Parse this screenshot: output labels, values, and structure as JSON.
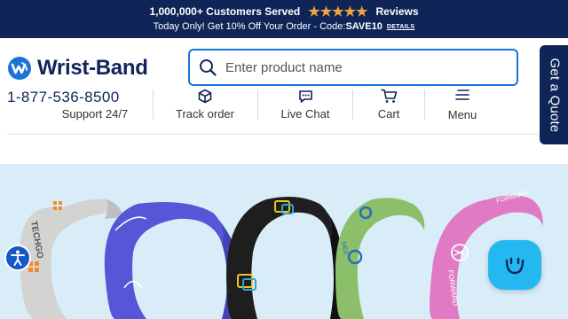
{
  "promo": {
    "customers": "1,000,000+ Customers Served",
    "stars": [
      "★",
      "★",
      "★",
      "★",
      "★"
    ],
    "reviews": "Reviews",
    "offer": "Today Only! Get 10% Off Your Order - Code: ",
    "code": "SAVE10",
    "details": "DETAILS"
  },
  "brand": {
    "name": "Wrist-Band"
  },
  "search": {
    "placeholder": "Enter product name"
  },
  "contact": {
    "phone": "1-877-536-8500"
  },
  "nav": {
    "support": "Support 24/7",
    "track": "Track order",
    "chat": "Live Chat",
    "cart": "Cart",
    "menu": "Menu"
  },
  "quote_tab": {
    "label": "Get a Quote"
  },
  "colors": {
    "navy": "#0f2557",
    "accent_blue": "#1a73d9",
    "star": "#f3a33a",
    "hero_bg": "#d9edf9",
    "chat_bubble": "#23b8f0"
  },
  "hero": {
    "bands": [
      {
        "color": "#d3d4d2",
        "print_text": "TECHGO",
        "icon": "dot-grid-logo"
      },
      {
        "color": "#5656d6",
        "print_text": "",
        "icon": "swoosh-logo"
      },
      {
        "color": "#1e1e1e",
        "print_text": "",
        "icon": "cube-logo"
      },
      {
        "color": "#8cbf6a",
        "print_text": "MEX",
        "icon": "circle-logo"
      },
      {
        "color": "#e07ac5",
        "print_text": "FORWARD",
        "icon": "arrow-logo"
      }
    ]
  }
}
